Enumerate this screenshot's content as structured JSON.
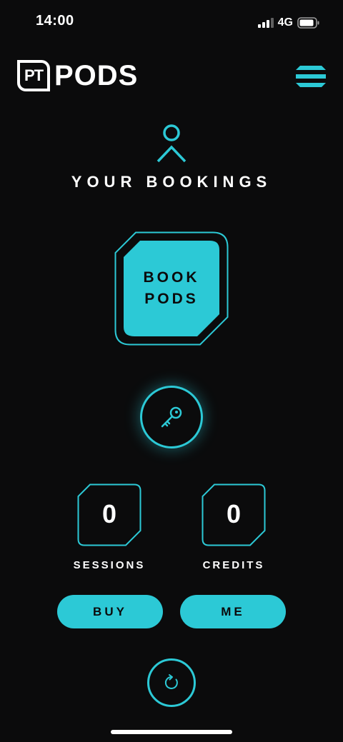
{
  "status_bar": {
    "time": "14:00",
    "network": "4G",
    "signal_icon": "signal-bars-icon",
    "battery_icon": "battery-icon"
  },
  "header": {
    "logo_mark": "PT",
    "logo_text": "PODS",
    "menu_icon": "menu-icon"
  },
  "page": {
    "title": "YOUR BOOKINGS",
    "user_icon": "user-icon"
  },
  "book_button": {
    "line1": "BOOK",
    "line2": "PODS"
  },
  "key_button": {
    "icon": "key-icon"
  },
  "stats": {
    "sessions": {
      "value": "0",
      "label": "SESSIONS"
    },
    "credits": {
      "value": "0",
      "label": "CREDITS"
    }
  },
  "actions": {
    "buy_label": "BUY",
    "me_label": "ME"
  },
  "refresh_button": {
    "icon": "refresh-icon"
  },
  "colors": {
    "accent": "#2cc9d6",
    "background": "#0b0b0c",
    "text": "#ffffff"
  }
}
